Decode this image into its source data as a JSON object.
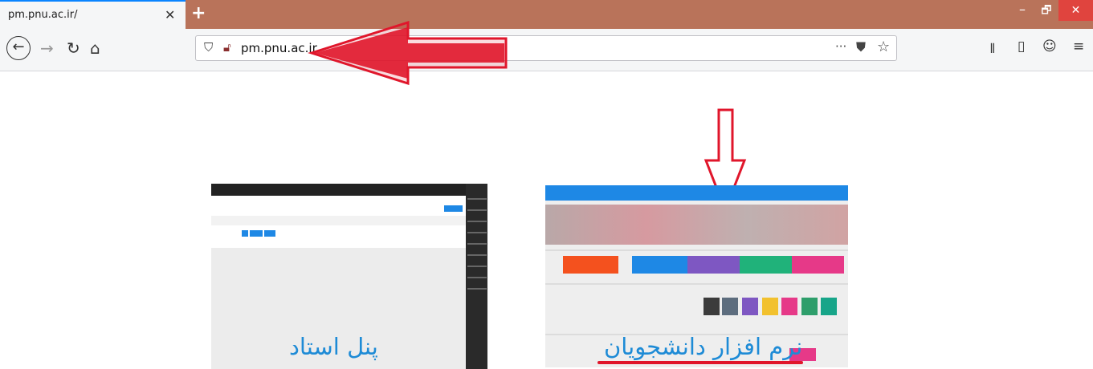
{
  "browser": {
    "tab": {
      "title": "pm.pnu.ac.ir/"
    },
    "url": {
      "host": "pm.pnu.ac.ir",
      "prefix": "pm."
    },
    "window_controls": {
      "minimize": "–",
      "maximize": "🗗",
      "close": "✕"
    },
    "icons": {
      "back": "back-arrow-icon",
      "forward": "forward-arrow-icon",
      "reload": "reload-icon",
      "home": "home-icon",
      "tracking": "shield-icon",
      "insecure": "insecure-lock-icon",
      "more": "more-icon",
      "pocket": "pocket-icon",
      "bookmark": "star-icon",
      "library": "library-icon",
      "sidebar": "sidebar-icon",
      "account": "account-icon",
      "menu": "hamburger-menu-icon"
    },
    "colors": {
      "titlebar": "#b9735a",
      "close": "#e0443e"
    }
  },
  "content": {
    "left_caption": "پنل استاد",
    "right_caption": "نرم افزار دانشجویان",
    "arrow_color": "#e0162b",
    "caption_color": "#1e8bd6"
  }
}
